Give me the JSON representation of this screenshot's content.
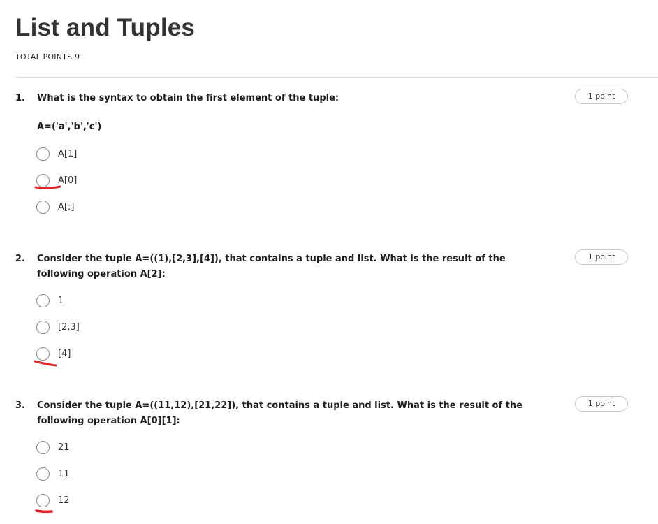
{
  "header": {
    "title": "List and Tuples",
    "total_points": "TOTAL POINTS 9"
  },
  "questions": [
    {
      "number": "1.",
      "text": "What is the syntax to obtain the first element of the tuple:",
      "subtext": "A=('a','b','c')",
      "points": "1 point",
      "options": [
        "A[1]",
        "A[0]",
        "A[:]"
      ],
      "marked_option": "A[0]"
    },
    {
      "number": "2.",
      "text": "Consider the tuple A=((1),[2,3],[4]), that contains a tuple and list. What is the result of the following operation A[2]:",
      "points": "1 point",
      "options": [
        "1",
        "[2,3]",
        "[4]"
      ],
      "marked_option": "[4]"
    },
    {
      "number": "3.",
      "text": "Consider the tuple A=((11,12),[21,22]), that contains a tuple and list. What is the result of the following operation A[0][1]:",
      "points": "1 point",
      "options": [
        "21",
        "11",
        "12"
      ],
      "marked_option": "12"
    }
  ],
  "colors": {
    "annotation_mark": "#e3262a",
    "radio_border": "#8a8a8a",
    "divider": "#dcdcdc"
  }
}
